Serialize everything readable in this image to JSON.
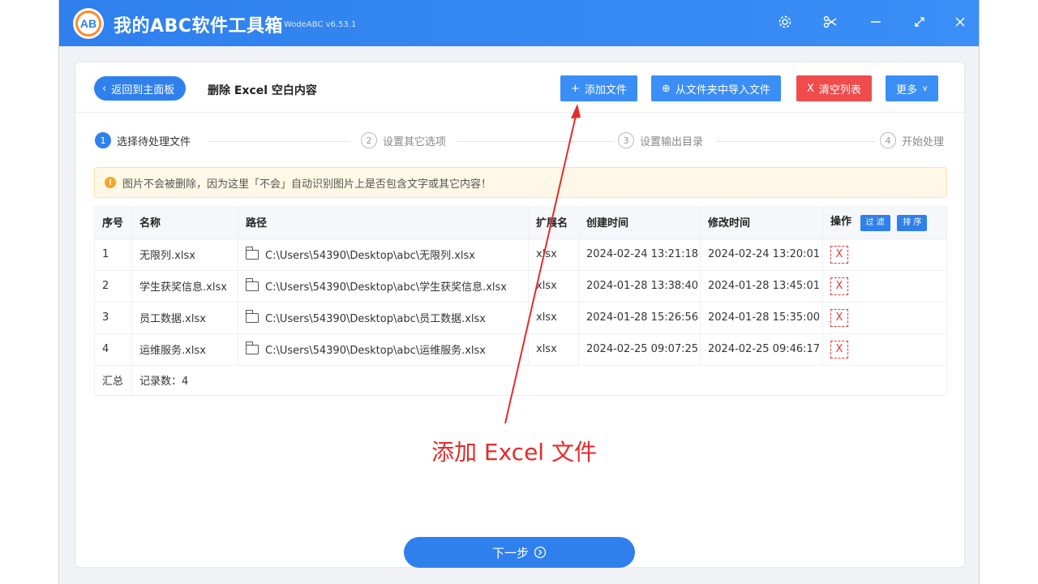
{
  "app": {
    "title": "我的ABC软件工具箱",
    "version": "WodeABC v6.53.1",
    "logo_text": "AB"
  },
  "titlebar_icons": [
    "settings-icon",
    "scissors-icon",
    "minimize-icon",
    "maximize-icon",
    "close-icon"
  ],
  "header": {
    "back_label": "返回到主面板",
    "page_title": "删除 Excel 空白内容",
    "add_file_label": "添加文件",
    "import_folder_label": "从文件夹中导入文件",
    "clear_list_label": "清空列表",
    "more_label": "更多"
  },
  "steps": [
    {
      "num": "1",
      "label": "选择待处理文件",
      "active": true
    },
    {
      "num": "2",
      "label": "设置其它选项",
      "active": false
    },
    {
      "num": "3",
      "label": "设置输出目录",
      "active": false
    },
    {
      "num": "4",
      "label": "开始处理",
      "active": false
    }
  ],
  "notice": {
    "icon": "!",
    "text": "图片不会被删除，因为这里「不会」自动识别图片上是否包含文字或其它内容！"
  },
  "table": {
    "headers": {
      "index": "序号",
      "name": "名称",
      "path": "路径",
      "ext": "扩展名",
      "created": "创建时间",
      "modified": "修改时间",
      "ops": "操作",
      "filter": "过 滤",
      "sort": "排 序"
    },
    "rows": [
      {
        "index": "1",
        "name": "无限列.xlsx",
        "path": "C:\\Users\\54390\\Desktop\\abc\\无限列.xlsx",
        "ext": "xlsx",
        "created": "2024-02-24 13:21:18",
        "modified": "2024-02-24 13:20:01",
        "del": "X"
      },
      {
        "index": "2",
        "name": "学生获奖信息.xlsx",
        "path": "C:\\Users\\54390\\Desktop\\abc\\学生获奖信息.xlsx",
        "ext": "xlsx",
        "created": "2024-01-28 13:38:40",
        "modified": "2024-01-28 13:45:01",
        "del": "X"
      },
      {
        "index": "3",
        "name": "员工数据.xlsx",
        "path": "C:\\Users\\54390\\Desktop\\abc\\员工数据.xlsx",
        "ext": "xlsx",
        "created": "2024-01-28 15:26:56",
        "modified": "2024-01-28 15:35:00",
        "del": "X"
      },
      {
        "index": "4",
        "name": "运维服务.xlsx",
        "path": "C:\\Users\\54390\\Desktop\\abc\\运维服务.xlsx",
        "ext": "xlsx",
        "created": "2024-02-25 09:07:25",
        "modified": "2024-02-25 09:46:17",
        "del": "X"
      }
    ],
    "summary_label": "汇总",
    "summary_count": "记录数：4"
  },
  "annotation": "添加 Excel 文件",
  "next_button": "下一步",
  "colors": {
    "primary": "#2f80ed",
    "danger": "#f04c4c",
    "annotation": "#e52b2b",
    "notice_bg": "#fff8e6"
  }
}
